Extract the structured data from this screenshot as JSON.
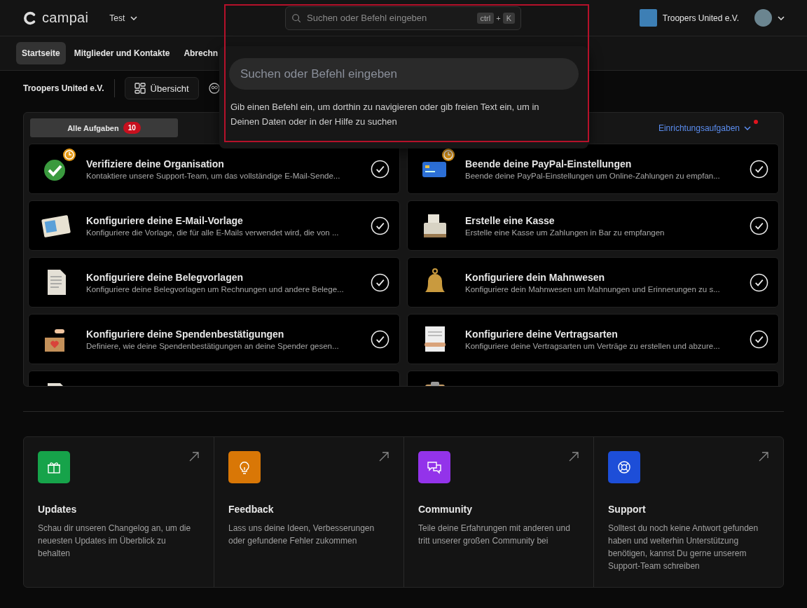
{
  "header": {
    "brand": "campai",
    "workspace": "Test",
    "search": {
      "placeholder": "Suchen oder Befehl eingeben",
      "keys": [
        "ctrl",
        "+",
        "K"
      ]
    },
    "organization": "Troopers United e.V."
  },
  "nav": [
    {
      "label": "Startseite",
      "selected": true
    },
    {
      "label": "Mitglieder und Kontakte",
      "selected": false
    },
    {
      "label": "Abrechn",
      "selected": false
    }
  ],
  "toolbar": {
    "organization": "Troopers United e.V.",
    "overview_button": "Übersicht"
  },
  "command_popover": {
    "placeholder": "Suchen oder Befehl eingeben",
    "hint": "Gib einen Befehl ein, um dorthin zu navigieren oder gib freien Text ein, um in Deinen Daten oder in der Hilfe zu suchen"
  },
  "task_panel": {
    "tab": {
      "label": "Alle Aufgaben",
      "count": "10",
      "selected": true
    },
    "setup_link": "Einrichtungsaufgaben",
    "setup_alert": true,
    "tasks": [
      {
        "kind": "verify",
        "pending": true,
        "title": "Verifiziere deine Organisation",
        "description": "Kontaktiere unsere Support-Team, um das vollständige E-Mail-Sende...",
        "done": true
      },
      {
        "kind": "card",
        "pending": true,
        "title": "Beende deine PayPal-Einstellungen",
        "description": "Beende deine PayPal-Einstellungen um Online-Zahlungen zu empfan...",
        "done": true
      },
      {
        "kind": "postcard",
        "pending": false,
        "title": "Konfiguriere deine E-Mail-Vorlage",
        "description": "Konfiguriere die Vorlage, die für alle E-Mails verwendet wird, die von ...",
        "done": true
      },
      {
        "kind": "register",
        "pending": false,
        "title": "Erstelle eine Kasse",
        "description": "Erstelle eine Kasse um Zahlungen in Bar zu empfangen",
        "done": true
      },
      {
        "kind": "document",
        "pending": false,
        "title": "Konfiguriere deine Belegvorlagen",
        "description": "Konfiguriere deine Belegvorlagen um Rechnungen und andere Belege...",
        "done": true
      },
      {
        "kind": "bell",
        "pending": false,
        "title": "Konfiguriere dein Mahnwesen",
        "description": "Konfiguriere dein Mahnwesen um Mahnungen und Erinnerungen zu s...",
        "done": true
      },
      {
        "kind": "donation",
        "pending": false,
        "title": "Konfiguriere deine Spendenbestätigungen",
        "description": "Definiere, wie deine Spendenbestätigungen an deine Spender gesen...",
        "done": true
      },
      {
        "kind": "contract",
        "pending": false,
        "title": "Konfiguriere deine Vertragsarten",
        "description": "Konfiguriere deine Vertragsarten um Verträge zu erstellen und abzure...",
        "done": true
      }
    ],
    "cut_off_tasks": [
      {
        "kind": "document"
      },
      {
        "kind": "clipboard"
      }
    ]
  },
  "resources": [
    {
      "kind": "gift",
      "color": "#16a34a",
      "title": "Updates",
      "text": "Schau dir unseren Changelog an, um die neuesten Updates im Überblick zu behalten"
    },
    {
      "kind": "bulb",
      "color": "#d97706",
      "title": "Feedback",
      "text": "Lass uns deine Ideen, Verbesserungen oder gefundene Fehler zukommen"
    },
    {
      "kind": "chat",
      "color": "#9333ea",
      "title": "Community",
      "text": "Teile deine Erfahrungen mit anderen und tritt unserer großen Community bei"
    },
    {
      "kind": "lifebuoy",
      "color": "#1d4ed8",
      "title": "Support",
      "text": "Solltest du noch keine Antwort gefunden haben und weiterhin Unterstützung benötigen, kannst Du gerne unserem Support-Team schreiben"
    }
  ]
}
